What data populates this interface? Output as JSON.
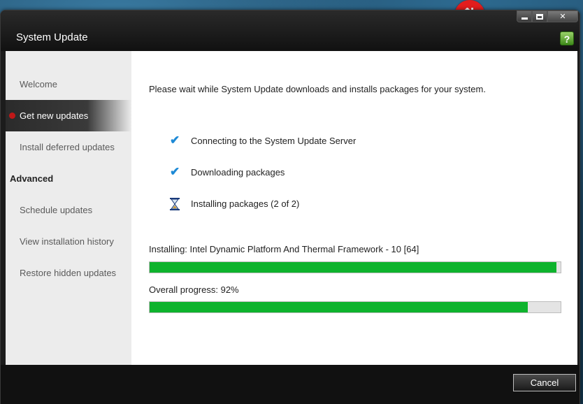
{
  "window": {
    "title": "System Update"
  },
  "sidebar": {
    "items": [
      {
        "label": "Welcome"
      },
      {
        "label": "Get new updates"
      },
      {
        "label": "Install deferred updates"
      },
      {
        "label": "Advanced"
      },
      {
        "label": "Schedule updates"
      },
      {
        "label": "View installation history"
      },
      {
        "label": "Restore hidden updates"
      }
    ],
    "active_item": "Get new updates"
  },
  "content": {
    "intro": "Please wait while System Update downloads and installs packages for your system.",
    "steps": [
      {
        "label": "Connecting to the System Update Server",
        "status": "done",
        "icon": "check-icon"
      },
      {
        "label": "Downloading packages",
        "status": "done",
        "icon": "check-icon"
      },
      {
        "label": "Installing packages (2 of 2)",
        "status": "in-progress",
        "icon": "hourglass-icon"
      }
    ],
    "current_install": "Installing: Intel Dynamic Platform And Thermal Framework - 10 [64]",
    "current_progress_percent": 99,
    "overall_label": "Overall progress: 92%",
    "overall_progress_percent": 92
  },
  "footer": {
    "cancel_label": "Cancel"
  },
  "colors": {
    "progress_fill": "#0eb32d",
    "check": "#1e8ad6",
    "active_dot": "#c01818",
    "sync_badge": "#e31d1d"
  }
}
